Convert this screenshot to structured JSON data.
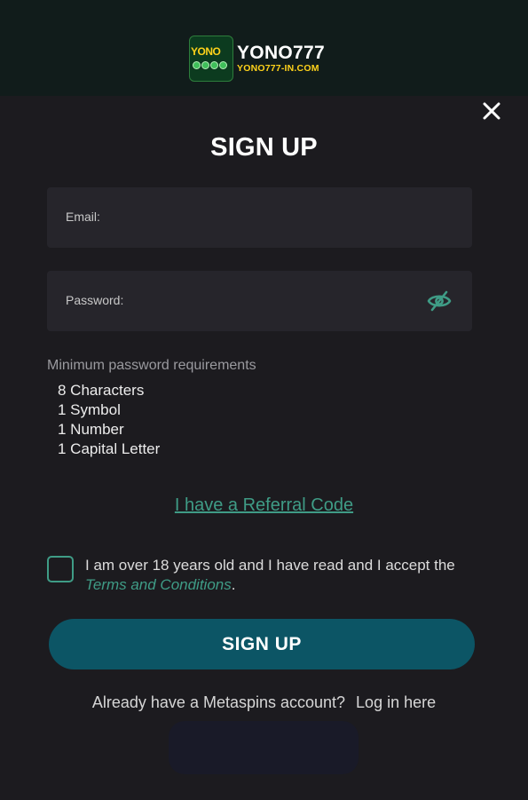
{
  "brand": {
    "badge_text": "YONO",
    "name": "YONO777",
    "domain": "YONO777-IN.COM",
    "colors": {
      "badge_bg": "#0c3b1f",
      "badge_text": "#ffd21a",
      "domain": "#ffd21a"
    }
  },
  "modal": {
    "title": "SIGN UP",
    "close_icon": "close-icon"
  },
  "form": {
    "email_label": "Email:",
    "email_value": "",
    "password_label": "Password:",
    "password_value": "",
    "password_toggle_icon": "eye-off-icon"
  },
  "requirements": {
    "title": "Minimum password requirements",
    "items": [
      "8 Characters",
      "1 Symbol",
      "1 Number",
      "1 Capital Letter"
    ]
  },
  "referral": {
    "link_text": "I have a Referral Code"
  },
  "terms": {
    "checked": false,
    "text_before": "I am over 18 years old and I have read and I accept the ",
    "link_text": "Terms and Conditions",
    "text_after": "."
  },
  "actions": {
    "signup_label": "SIGN UP"
  },
  "login": {
    "prompt": "Already have a Metaspins account?",
    "link_text": "Log in here"
  },
  "colors": {
    "background": "#1c1b1f",
    "header": "#111c1b",
    "field": "#26252b",
    "accent": "#3f9c86",
    "button": "#0c5565"
  }
}
